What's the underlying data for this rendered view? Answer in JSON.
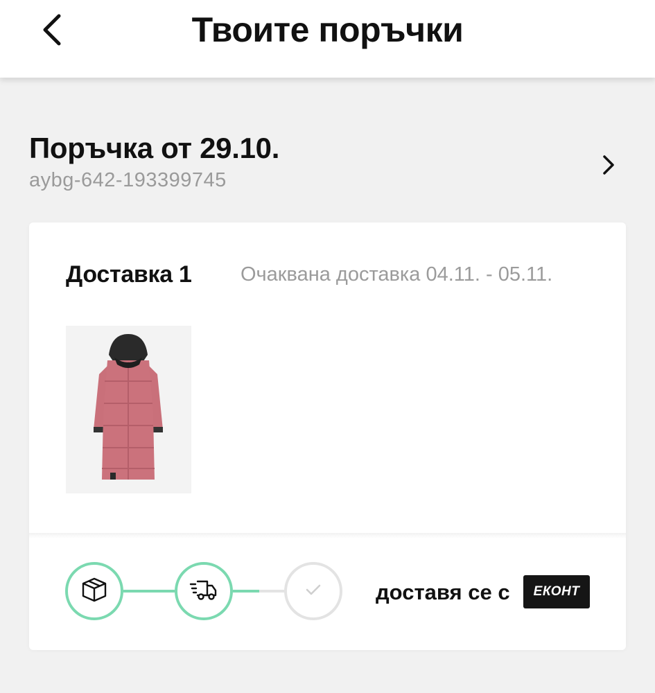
{
  "header": {
    "title": "Твоите поръчки",
    "back_icon": "chevron-left-icon"
  },
  "order": {
    "title": "Поръчка от 29.10.",
    "id": "aybg-642-193399745",
    "open_icon": "chevron-right-icon"
  },
  "delivery": {
    "label": "Доставка 1",
    "expected": "Очаквана доставка 04.11. - 05.11.",
    "product": {
      "image": "pink-long-puffer-coat",
      "color": "#c9707a"
    },
    "progress": {
      "steps": [
        {
          "icon": "package-icon",
          "status": "done"
        },
        {
          "icon": "delivery-truck-icon",
          "status": "done"
        },
        {
          "icon": "checkmark-icon",
          "status": "pending"
        }
      ],
      "fraction": 0.62
    },
    "carrier_text": "доставя се с",
    "carrier_logo": "ЕКОНТ"
  },
  "colors": {
    "accent": "#7bd9b0",
    "pending": "#e3e3e3",
    "muted_text": "#9b9b9b"
  }
}
